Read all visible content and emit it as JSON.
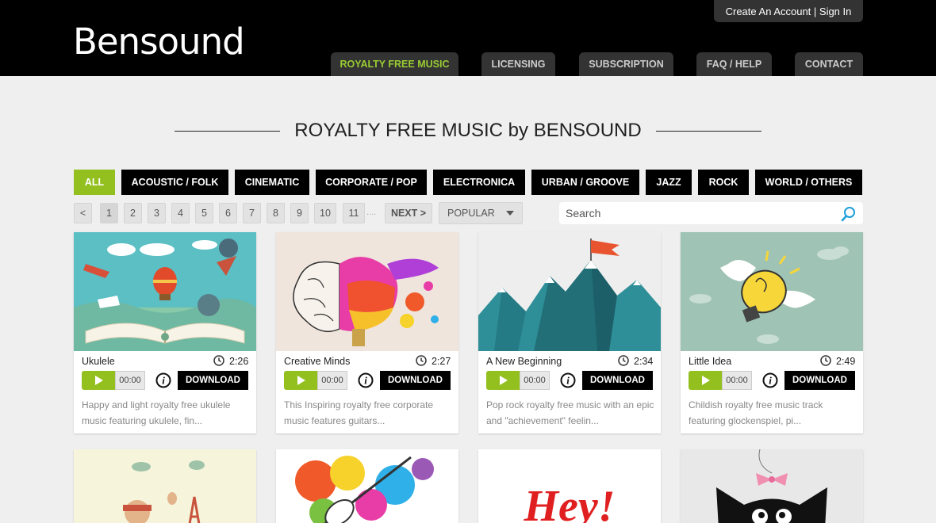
{
  "header": {
    "logo": "Bensound",
    "account_link": "Create An Account | Sign In",
    "nav": [
      "ROYALTY FREE MUSIC",
      "LICENSING",
      "SUBSCRIPTION",
      "FAQ / HELP",
      "CONTACT"
    ],
    "active_nav": "ROYALTY FREE MUSIC"
  },
  "page_title": "ROYALTY FREE MUSIC by BENSOUND",
  "categories": [
    "ALL",
    "ACOUSTIC / FOLK",
    "CINEMATIC",
    "CORPORATE / POP",
    "ELECTRONICA",
    "URBAN / GROOVE",
    "JAZZ",
    "ROCK",
    "WORLD / OTHERS"
  ],
  "active_category": "ALL",
  "pagination": {
    "prev": "<",
    "pages": [
      "1",
      "2",
      "3",
      "4",
      "5",
      "6",
      "7",
      "8",
      "9",
      "10",
      "11"
    ],
    "current": "1",
    "ellipsis": "....",
    "next": "NEXT >"
  },
  "sort": {
    "selected": "POPULAR"
  },
  "search": {
    "placeholder": "Search"
  },
  "tracks": [
    {
      "title": "Ukulele",
      "duration": "2:26",
      "time": "00:00",
      "download": "DOWNLOAD",
      "description": "Happy and light royalty free ukulele music featuring ukulele, fin..."
    },
    {
      "title": "Creative Minds",
      "duration": "2:27",
      "time": "00:00",
      "download": "DOWNLOAD",
      "description": "This Inspiring royalty free corporate music features guitars..."
    },
    {
      "title": "A New Beginning",
      "duration": "2:34",
      "time": "00:00",
      "download": "DOWNLOAD",
      "description": "Pop rock royalty free music with an epic and \"achievement\" feelin..."
    },
    {
      "title": "Little Idea",
      "duration": "2:49",
      "time": "00:00",
      "download": "DOWNLOAD",
      "description": "Childish royalty free music track featuring glockenspiel, pi..."
    }
  ],
  "second_row_text": {
    "hey": "Hey!"
  },
  "colors": {
    "accent": "#93c01f",
    "header_bg": "#000000",
    "page_bg": "#efefef"
  }
}
